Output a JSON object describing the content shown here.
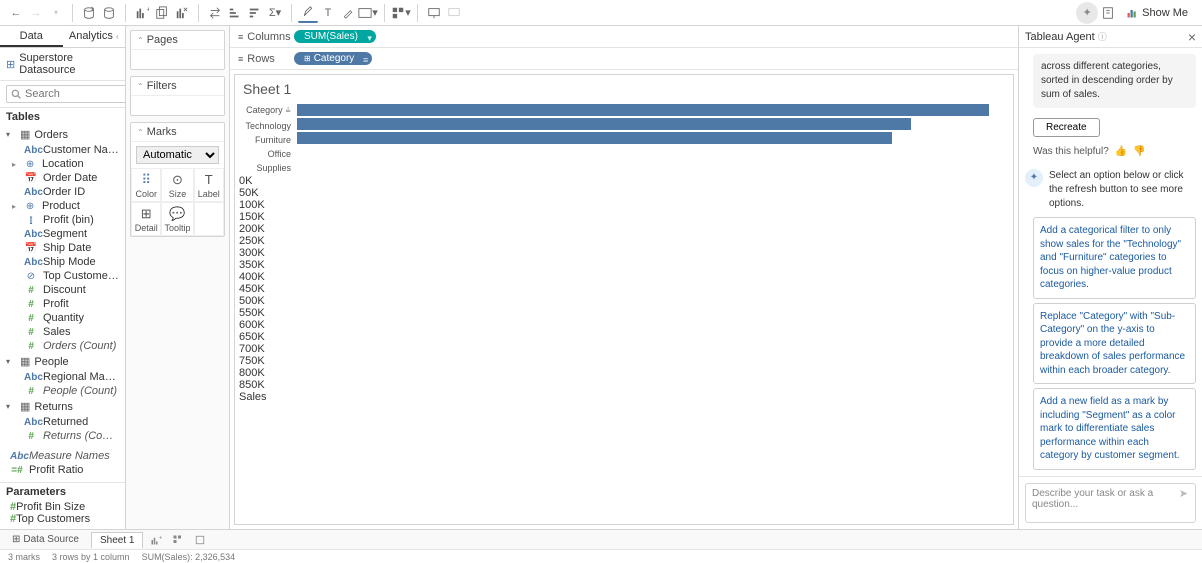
{
  "data_tabs": {
    "data": "Data",
    "analytics": "Analytics"
  },
  "datasource": "Superstore Datasource",
  "search_placeholder": "Search",
  "tables_header": "Tables",
  "tables": {
    "orders": {
      "name": "Orders",
      "fields": [
        {
          "icon": "abc",
          "name": "Customer Name"
        },
        {
          "icon": "geo",
          "name": "Location",
          "expand": true
        },
        {
          "icon": "date",
          "name": "Order Date"
        },
        {
          "icon": "abc",
          "name": "Order ID"
        },
        {
          "icon": "geo",
          "name": "Product",
          "expand": true
        },
        {
          "icon": "bar",
          "name": "Profit (bin)"
        },
        {
          "icon": "abc",
          "name": "Segment"
        },
        {
          "icon": "date",
          "name": "Ship Date"
        },
        {
          "icon": "abc",
          "name": "Ship Mode"
        },
        {
          "icon": "set",
          "name": "Top Customers by P..."
        },
        {
          "icon": "num",
          "name": "Discount"
        },
        {
          "icon": "num",
          "name": "Profit"
        },
        {
          "icon": "num",
          "name": "Quantity"
        },
        {
          "icon": "num",
          "name": "Sales"
        },
        {
          "icon": "num",
          "name": "Orders (Count)",
          "italic": true
        }
      ]
    },
    "people": {
      "name": "People",
      "fields": [
        {
          "icon": "abc",
          "name": "Regional Manager"
        },
        {
          "icon": "num",
          "name": "People (Count)",
          "italic": true
        }
      ]
    },
    "returns": {
      "name": "Returns",
      "fields": [
        {
          "icon": "abc",
          "name": "Returned"
        },
        {
          "icon": "num",
          "name": "Returns (Count)",
          "italic": true
        }
      ]
    },
    "extra": [
      {
        "icon": "abc",
        "name": "Measure Names",
        "italic": true
      },
      {
        "icon": "calc",
        "name": "Profit Ratio"
      }
    ]
  },
  "parameters_header": "Parameters",
  "parameters": [
    {
      "icon": "num",
      "name": "Profit Bin Size"
    },
    {
      "icon": "num",
      "name": "Top Customers"
    }
  ],
  "cards": {
    "pages": "Pages",
    "filters": "Filters",
    "marks": "Marks",
    "mark_type": "Automatic",
    "mark_cells": {
      "color": "Color",
      "size": "Size",
      "label": "Label",
      "detail": "Detail",
      "tooltip": "Tooltip"
    }
  },
  "shelves": {
    "columns": "Columns",
    "rows": "Rows"
  },
  "pills": {
    "columns": "SUM(Sales)",
    "rows": "Category"
  },
  "sheet_title": "Sheet 1",
  "chart_data": {
    "type": "bar",
    "ylabel": "Category",
    "categories": [
      "Technology",
      "Furniture",
      "Office Supplies"
    ],
    "values": [
      836000,
      742000,
      719000
    ],
    "xlabel": "Sales",
    "xticks": [
      "0K",
      "50K",
      "100K",
      "150K",
      "200K",
      "250K",
      "300K",
      "350K",
      "400K",
      "450K",
      "500K",
      "550K",
      "600K",
      "650K",
      "700K",
      "750K",
      "800K",
      "850K"
    ],
    "xmax": 860000
  },
  "agent": {
    "title": "Tableau Agent",
    "prior": "across different categories, sorted in descending order by sum of sales.",
    "recreate": "Recreate",
    "helpful": "Was this helpful?",
    "prompt": "Select an option below or click the refresh button to see more options.",
    "suggestions": [
      "Add a categorical filter to only show sales for the \"Technology\" and \"Furniture\" categories to focus on higher-value product categories.",
      "Replace \"Category\" with \"Sub-Category\" on the y-axis to provide a more detailed breakdown of sales performance within each broader category.",
      "Add a new field as a mark by including \"Segment\" as a color mark to differentiate sales performance within each category by customer segment."
    ],
    "input_placeholder": "Describe your task or ask a question..."
  },
  "footer": {
    "datasource": "Data Source",
    "sheet": "Sheet 1",
    "status": [
      "3 marks",
      "3 rows by 1 column",
      "SUM(Sales): 2,326,534"
    ]
  },
  "showme": "Show Me"
}
